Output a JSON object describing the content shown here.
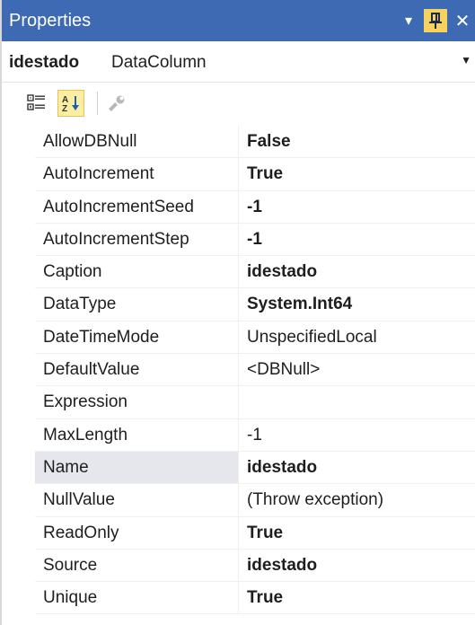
{
  "titlebar": {
    "title": "Properties",
    "dropdown_icon": "▾",
    "pin_icon": "pin-icon",
    "close_icon": "✕"
  },
  "object": {
    "name": "idestado",
    "type": "DataColumn",
    "dropdown_icon": "▼"
  },
  "toolbar": {
    "categorized": "categorized-icon",
    "alphabetical": "alphabetical-icon",
    "property_pages": "wrench-icon"
  },
  "properties": [
    {
      "name": "AllowDBNull",
      "value": "False",
      "bold": true
    },
    {
      "name": "AutoIncrement",
      "value": "True",
      "bold": true
    },
    {
      "name": "AutoIncrementSeed",
      "value": "-1",
      "bold": true
    },
    {
      "name": "AutoIncrementStep",
      "value": "-1",
      "bold": true
    },
    {
      "name": "Caption",
      "value": "idestado",
      "bold": true
    },
    {
      "name": "DataType",
      "value": "System.Int64",
      "bold": true
    },
    {
      "name": "DateTimeMode",
      "value": "UnspecifiedLocal",
      "bold": false
    },
    {
      "name": "DefaultValue",
      "value": "<DBNull>",
      "bold": false
    },
    {
      "name": "Expression",
      "value": "",
      "bold": false
    },
    {
      "name": "MaxLength",
      "value": "-1",
      "bold": false
    },
    {
      "name": "Name",
      "value": "idestado",
      "bold": true
    },
    {
      "name": "NullValue",
      "value": "(Throw exception)",
      "bold": false
    },
    {
      "name": "ReadOnly",
      "value": "True",
      "bold": true
    },
    {
      "name": "Source",
      "value": "idestado",
      "bold": true
    },
    {
      "name": "Unique",
      "value": "True",
      "bold": true
    }
  ],
  "colors": {
    "titlebar": "#3d6ab3",
    "pin_button": "#f7d25c",
    "selected_row": "#e6e7ed"
  }
}
